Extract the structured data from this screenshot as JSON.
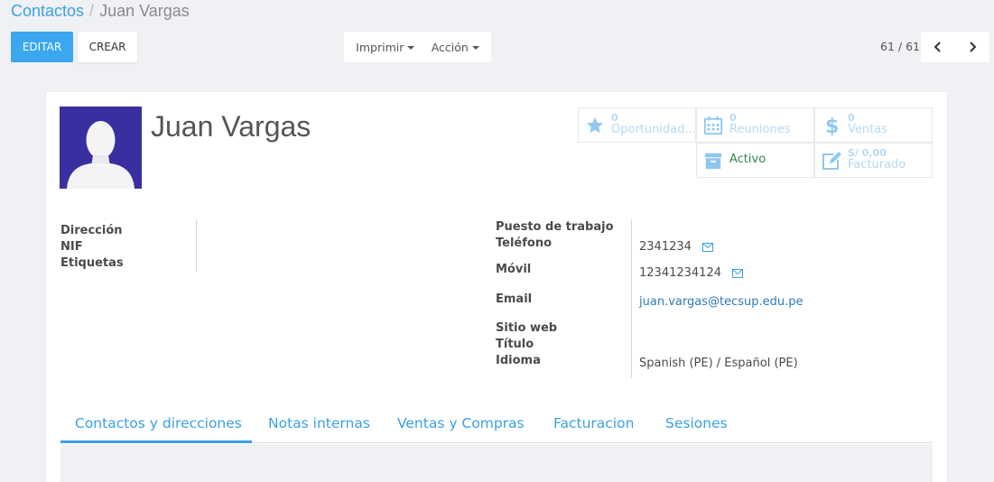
{
  "breadcrumb": {
    "parent": "Contactos",
    "separator": "/",
    "current": "Juan Vargas"
  },
  "toolbar": {
    "edit_label": "EDITAR",
    "create_label": "CREAR",
    "print_label": "Imprimir",
    "action_label": "Acción"
  },
  "pager": {
    "text": "61 / 61"
  },
  "partner": {
    "name": "Juan Vargas"
  },
  "stats": {
    "opportunities": {
      "value": "0",
      "label": "Oportunidad..."
    },
    "meetings": {
      "value": "0",
      "label": "Reuniones"
    },
    "sales": {
      "value": "0",
      "label": "Ventas"
    },
    "active": {
      "label": "Activo"
    },
    "invoiced": {
      "value": "S/ 0,00",
      "label": "Facturado"
    }
  },
  "left_fields": {
    "address_label": "Dirección",
    "nif_label": "NIF",
    "tags_label": "Etiquetas"
  },
  "right_fields": {
    "job_label": "Puesto de trabajo",
    "phone_label": "Teléfono",
    "phone_value": "2341234",
    "mobile_label": "Móvil",
    "mobile_value": "12341234124",
    "email_label": "Email",
    "email_value": "juan.vargas@tecsup.edu.pe",
    "website_label": "Sitio web",
    "title_label": "Título",
    "language_label": "Idioma",
    "language_value": "Spanish (PE) / Español (PE)"
  },
  "tabs": [
    "Contactos y direcciones",
    "Notas internas",
    "Ventas y Compras",
    "Facturacion",
    "Sesiones"
  ],
  "colors": {
    "accent": "#3aa0e6",
    "active_green": "#2f8a4a",
    "avatar_bg": "#3a2fa0",
    "stat_muted": "#b5d9f3"
  }
}
